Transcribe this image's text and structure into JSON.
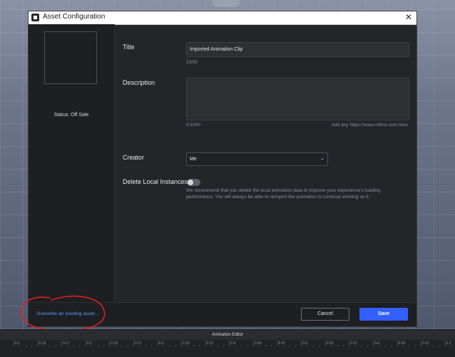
{
  "window": {
    "title": "Asset Configuration",
    "close_glyph": "✕"
  },
  "sidebar": {
    "status": "Status: Off Sale"
  },
  "form": {
    "title_label": "Title",
    "title_value": "Imported Animation Clip",
    "title_count": "23/50",
    "description_label": "Description",
    "description_value": "",
    "description_count": "0/1000",
    "description_hint": "Add any https://www.roblox.com links",
    "creator_label": "Creator",
    "creator_value": "Me",
    "delete_label": "Delete Local Instances",
    "delete_toggle_on": false,
    "delete_help": "We recommend that you delete the local animation data to improve your experience's loading performance. You will always be able to reimport the animation to continue working on it."
  },
  "footer": {
    "overwrite_link": "Overwrite an existing asset...",
    "cancel_label": "Cancel",
    "save_label": "Save"
  },
  "colors": {
    "accent": "#335fff",
    "link": "#5d9cff",
    "annotation": "#e02020"
  },
  "animation_editor": {
    "title": "Animation Editor",
    "ticks": [
      "0.1",
      "0.13",
      "0.17",
      "0.2",
      "0.23",
      "0.27",
      "0.3",
      "0.33",
      "0.37",
      "0.4",
      "0.43",
      "0.47",
      "0.5",
      "0.53",
      "0.57",
      "0.6",
      "0.63",
      "0.67",
      "0.7"
    ]
  }
}
